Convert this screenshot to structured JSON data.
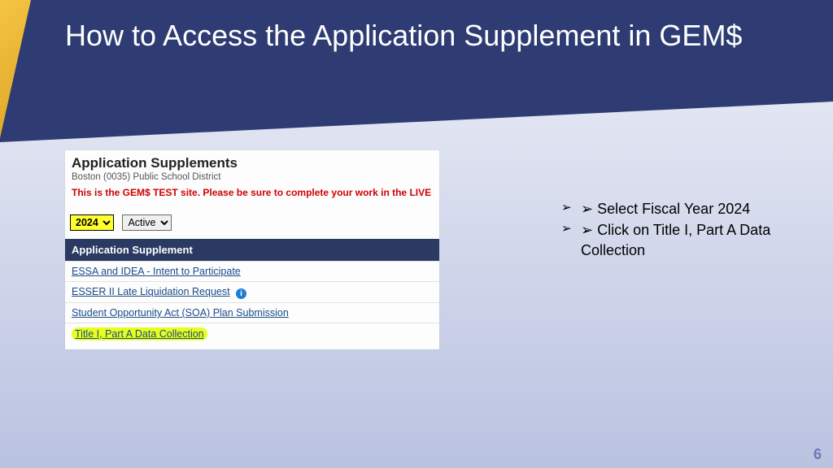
{
  "title": "How to Access the Application Supplement in GEM$",
  "panel": {
    "heading": "Application Supplements",
    "subheading": "Boston (0035) Public School District",
    "warning": "This is the GEM$ TEST site. Please be sure to complete your work in the LIVE site.",
    "year_selected": "2024",
    "status_selected": "Active",
    "table_header": "Application Supplement",
    "rows": [
      {
        "label": "ESSA and IDEA - Intent to Participate",
        "highlighted": false,
        "has_info": false
      },
      {
        "label": "ESSER II Late Liquidation Request",
        "highlighted": false,
        "has_info": true
      },
      {
        "label": "Student Opportunity Act (SOA) Plan Submission",
        "highlighted": false,
        "has_info": false
      },
      {
        "label": "Title I, Part A Data Collection",
        "highlighted": true,
        "has_info": false
      }
    ]
  },
  "bullets": [
    "Select Fiscal Year 2024",
    "Click on Title I, Part A Data Collection"
  ],
  "page_number": "6",
  "info_glyph": "i",
  "arrow_glyph": "➢"
}
